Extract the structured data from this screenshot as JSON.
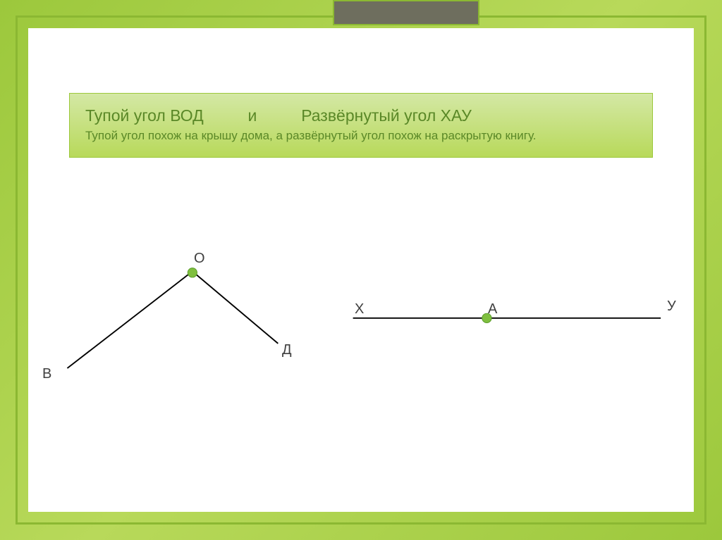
{
  "title": {
    "obtuse_angle": "Тупой угол ВОД",
    "connector": "и",
    "straight_angle": "Развёрнутый угол ХАУ",
    "description": "Тупой угол похож на крышу дома, а развёрнутый угол похож на раскрытую книгу."
  },
  "diagram": {
    "obtuse": {
      "vertex_label": "О",
      "left_point_label": "В",
      "right_point_label": "Д"
    },
    "straight": {
      "left_label": "Х",
      "vertex_label": "А",
      "right_label": "У"
    }
  },
  "chart_data": {
    "type": "diagram",
    "figures": [
      {
        "name": "obtuse_angle_VOD",
        "angle_type": "obtuse",
        "vertex": "О",
        "rays": [
          "В",
          "Д"
        ],
        "approx_angle_deg": 125,
        "description": "Obtuse angle resembling a house roof"
      },
      {
        "name": "straight_angle_XAU",
        "angle_type": "straight",
        "vertex": "А",
        "rays": [
          "Х",
          "У"
        ],
        "approx_angle_deg": 180,
        "description": "Straight angle resembling an open book"
      }
    ]
  }
}
